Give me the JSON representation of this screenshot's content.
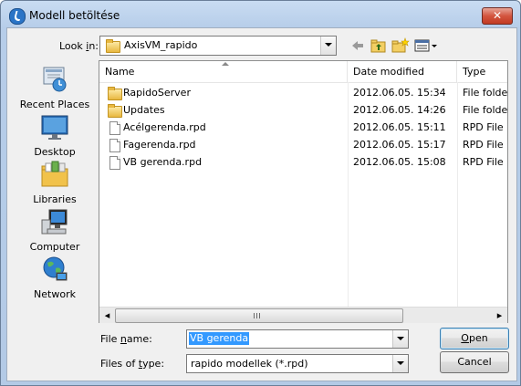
{
  "window": {
    "title": "Modell betöltése",
    "close_glyph": "✕"
  },
  "toolbar": {
    "look_in_label": "Look in:",
    "look_in_value": "AxisVM_rapido",
    "icons": [
      "back-arrow-icon",
      "up-folder-icon",
      "new-folder-icon",
      "view-menu-icon"
    ]
  },
  "places": [
    {
      "label": "Recent Places",
      "icon": "recent-places-icon"
    },
    {
      "label": "Desktop",
      "icon": "desktop-icon"
    },
    {
      "label": "Libraries",
      "icon": "libraries-icon"
    },
    {
      "label": "Computer",
      "icon": "computer-icon"
    },
    {
      "label": "Network",
      "icon": "network-icon"
    }
  ],
  "file_list": {
    "columns": [
      "Name",
      "Date modified",
      "Type"
    ],
    "rows": [
      {
        "name": "RapidoServer",
        "date": "2012.06.05. 15:34",
        "type": "File folder",
        "icon": "folder-icon"
      },
      {
        "name": "Updates",
        "date": "2012.06.05. 14:26",
        "type": "File folder",
        "icon": "folder-icon"
      },
      {
        "name": "Acélgerenda.rpd",
        "date": "2012.06.05. 15:11",
        "type": "RPD File",
        "icon": "file-icon"
      },
      {
        "name": "Fagerenda.rpd",
        "date": "2012.06.05. 15:17",
        "type": "RPD File",
        "icon": "file-icon"
      },
      {
        "name": "VB gerenda.rpd",
        "date": "2012.06.05. 15:08",
        "type": "RPD File",
        "icon": "file-icon"
      }
    ],
    "scroll_left_glyph": "◂",
    "scroll_right_glyph": "▸"
  },
  "form": {
    "file_name_label": "File name:",
    "file_name_value": "VB gerenda",
    "files_of_type_label": "Files of type:",
    "files_of_type_value": "rapido modellek (*.rpd)"
  },
  "buttons": {
    "open": "Open",
    "cancel": "Cancel"
  },
  "colors": {
    "selection": "#3399ff",
    "title_close": "#c8402a"
  }
}
